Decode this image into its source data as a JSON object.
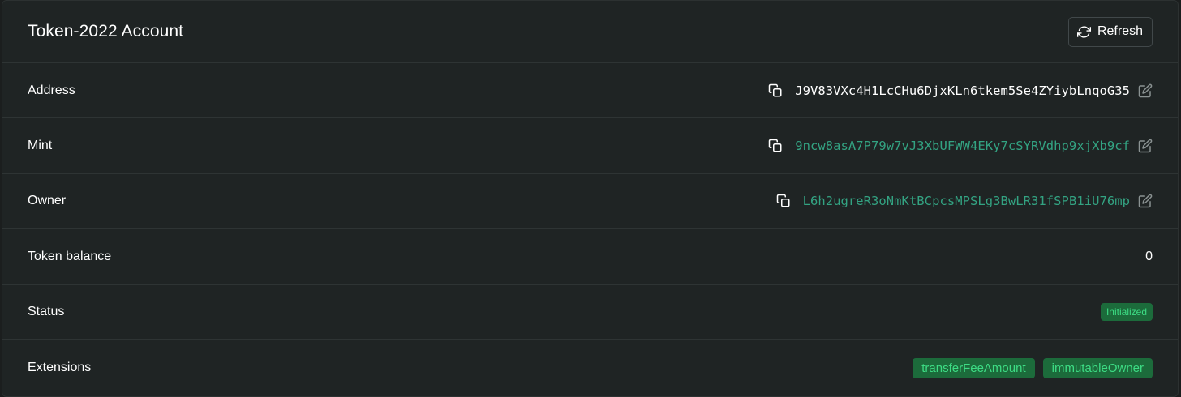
{
  "header": {
    "title": "Token-2022 Account",
    "refresh_label": "Refresh"
  },
  "rows": {
    "address": {
      "label": "Address",
      "value": "J9V83VXc4H1LcCHu6DjxKLn6tkem5Se4ZYiybLnqoG35"
    },
    "mint": {
      "label": "Mint",
      "value": "9ncw8asA7P79w7vJ3XbUFWW4EKy7cSYRVdhp9xjXb9cf"
    },
    "owner": {
      "label": "Owner",
      "value": "L6h2ugreR3oNmKtBCpcsMPSLg3BwLR31fSPB1iU76mp"
    },
    "token_balance": {
      "label": "Token balance",
      "value": "0"
    },
    "status": {
      "label": "Status",
      "value": "Initialized"
    },
    "extensions": {
      "label": "Extensions",
      "items": [
        "transferFeeAmount",
        "immutableOwner"
      ]
    }
  },
  "icons": {
    "refresh": "refresh-icon",
    "copy": "copy-icon",
    "edit": "edit-icon"
  },
  "colors": {
    "background": "#1f2424",
    "link": "#33a382",
    "badge_bg": "#1c6b3b",
    "badge_text": "#3ddc84"
  }
}
